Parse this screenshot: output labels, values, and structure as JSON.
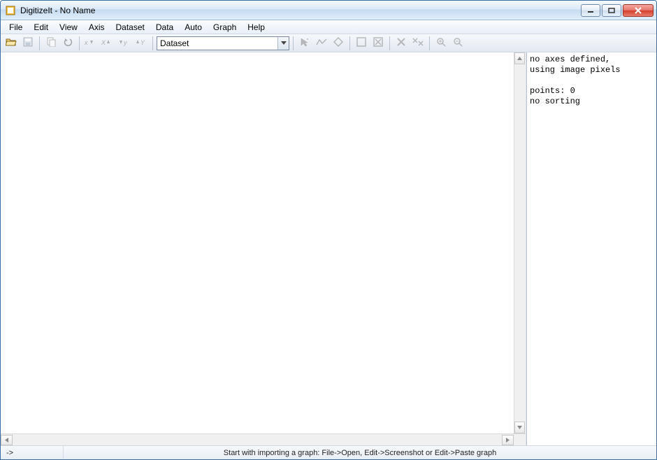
{
  "title": "DigitizeIt - No Name",
  "menu": [
    "File",
    "Edit",
    "View",
    "Axis",
    "Dataset",
    "Data",
    "Auto",
    "Graph",
    "Help"
  ],
  "toolbar": {
    "dataset_label": "Dataset"
  },
  "info_panel": {
    "line1": "no axes defined,",
    "line2": "using image pixels",
    "line3": "",
    "line4": "points: 0",
    "line5": "no sorting"
  },
  "status": {
    "coords": "->",
    "hint": "Start with importing a graph: File->Open, Edit->Screenshot or Edit->Paste graph"
  }
}
